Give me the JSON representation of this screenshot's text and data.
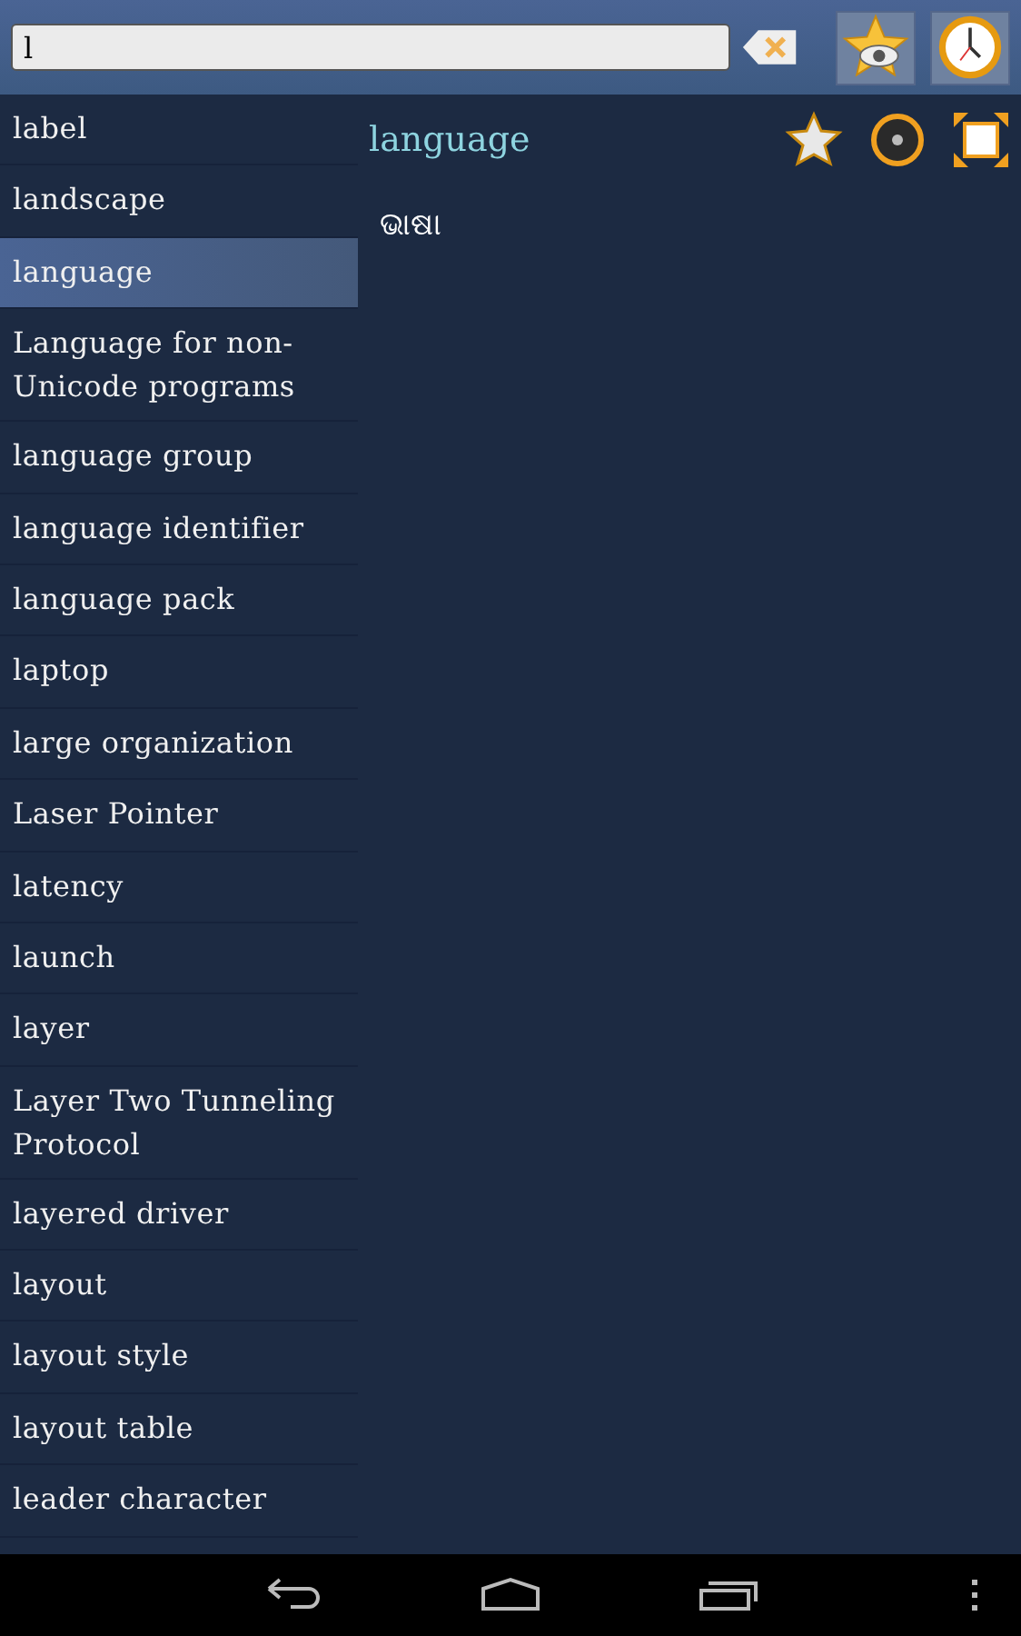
{
  "search": {
    "value": "l"
  },
  "words": [
    {
      "text": "label",
      "selected": false
    },
    {
      "text": "landscape",
      "selected": false
    },
    {
      "text": "language",
      "selected": true
    },
    {
      "text": "Language for non-Unicode programs",
      "selected": false
    },
    {
      "text": "language group",
      "selected": false
    },
    {
      "text": "language identifier",
      "selected": false
    },
    {
      "text": "language pack",
      "selected": false
    },
    {
      "text": "laptop",
      "selected": false
    },
    {
      "text": "large organization",
      "selected": false
    },
    {
      "text": "Laser Pointer",
      "selected": false
    },
    {
      "text": "latency",
      "selected": false
    },
    {
      "text": "launch",
      "selected": false
    },
    {
      "text": "layer",
      "selected": false
    },
    {
      "text": "Layer Two Tunneling Protocol",
      "selected": false
    },
    {
      "text": "layered driver",
      "selected": false
    },
    {
      "text": "layout",
      "selected": false
    },
    {
      "text": "layout style",
      "selected": false
    },
    {
      "text": "layout table",
      "selected": false
    },
    {
      "text": "leader character",
      "selected": false
    }
  ],
  "entry": {
    "headword": "language",
    "translation": "ଭାଷା"
  }
}
